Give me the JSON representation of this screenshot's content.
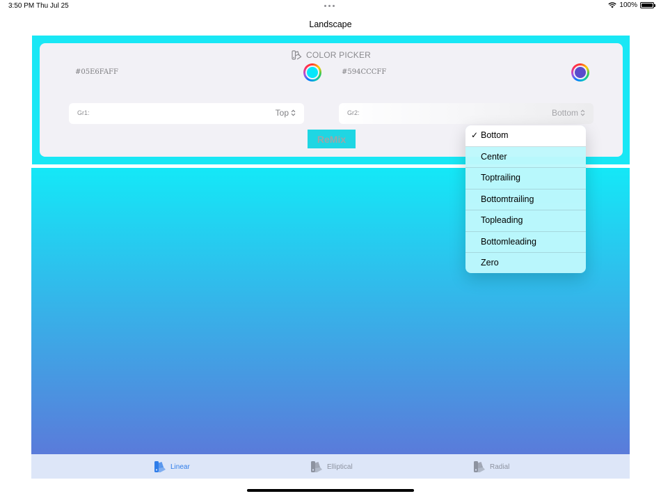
{
  "status_bar": {
    "time": "3:50 PM",
    "date": "Thu Jul 25",
    "battery": "100%"
  },
  "nav": {
    "title": "Landscape"
  },
  "color_picker": {
    "header_icon": "swatch-palette-icon",
    "title": "COLOR PICKER",
    "color1": {
      "hex_label": "#05E6FAFF",
      "color": "#05E6FA"
    },
    "color2": {
      "hex_label": "#594CCCFF",
      "color": "#594CCC"
    }
  },
  "gradient": {
    "gr1": {
      "label": "Gr1:",
      "value": "Top"
    },
    "gr2": {
      "label": "Gr2:",
      "value": "Bottom"
    },
    "remix_label": "ReMix",
    "remix_color": "#1FD6E3",
    "preview_start": "#14E8F7",
    "preview_end": "#5A7BDA"
  },
  "dropdown": {
    "selected": "Bottom",
    "items": [
      "Bottom",
      "Center",
      "Toptrailing",
      "Bottomtrailing",
      "Topleading",
      "Bottomleading",
      "Zero"
    ]
  },
  "tabs": [
    {
      "label": "Linear",
      "icon": "swatch-palette-icon",
      "active": true
    },
    {
      "label": "Elliptical",
      "icon": "swatch-palette-icon",
      "active": false
    },
    {
      "label": "Radial",
      "icon": "swatch-palette-icon",
      "active": false
    }
  ],
  "colors": {
    "frame": "#19E7F5",
    "card": "#F2F1F6",
    "tab_active": "#2F7DE9",
    "tab_bar": "#DDE6F8"
  }
}
